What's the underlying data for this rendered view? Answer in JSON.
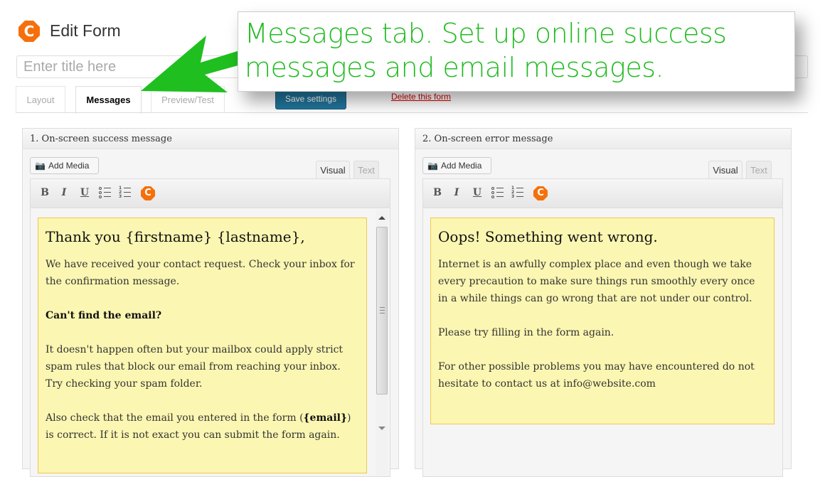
{
  "header": {
    "logo_letter": "C",
    "title": "Edit Form",
    "title_input_placeholder": "Enter title here",
    "title_input_value": ""
  },
  "tabs": [
    {
      "label": "Layout",
      "active": false
    },
    {
      "label": "Messages",
      "active": true
    },
    {
      "label": "Preview/Test",
      "active": false
    }
  ],
  "actions": {
    "save_label": "Save settings",
    "delete_label": "Delete this form"
  },
  "callout": {
    "text": "Messages tab. Set up online success\nmessages and email messages.",
    "color": "#22bb22"
  },
  "panels": [
    {
      "heading": "1. On-screen success message",
      "add_media_label": "Add Media",
      "mode_tabs": {
        "visual": "Visual",
        "text": "Text",
        "active": "Visual"
      },
      "toolbar": {
        "bold": "B",
        "italic": "I",
        "underline": "U",
        "plugin_letter": "C"
      },
      "content": {
        "heading": "Thank you {firstname} {lastname},",
        "p1": "We have received your contact request. Check your inbox for the confirmation message.",
        "p2": "Can't find the email?",
        "p3": "It doesn't happen often but your mailbox could apply strict spam rules that block our email from reaching your inbox. Try checking your spam folder.",
        "p4_before": "Also check that the email you entered in the form (",
        "p4_tag": "{email}",
        "p4_after": ") is correct. If it is not exact you can submit the form again."
      }
    },
    {
      "heading": "2. On-screen error message",
      "add_media_label": "Add Media",
      "mode_tabs": {
        "visual": "Visual",
        "text": "Text",
        "active": "Visual"
      },
      "toolbar": {
        "bold": "B",
        "italic": "I",
        "underline": "U",
        "plugin_letter": "C"
      },
      "content": {
        "heading": "Oops! Something went wrong.",
        "p1": "Internet is an awfully complex place and even though we take every precaution to make sure things run smoothly every once in a while things can go wrong that are not under our control.",
        "p2": "Please try filling in the form again.",
        "p3": "For other possible problems you may have encountered do not hesitate to contact us at info@website.com"
      }
    }
  ],
  "colors": {
    "brand_orange": "#f5700c",
    "primary_button": "#21759b",
    "delete_link": "#dd0000",
    "message_background": "#fbf6b1",
    "message_border": "#f0c850"
  }
}
